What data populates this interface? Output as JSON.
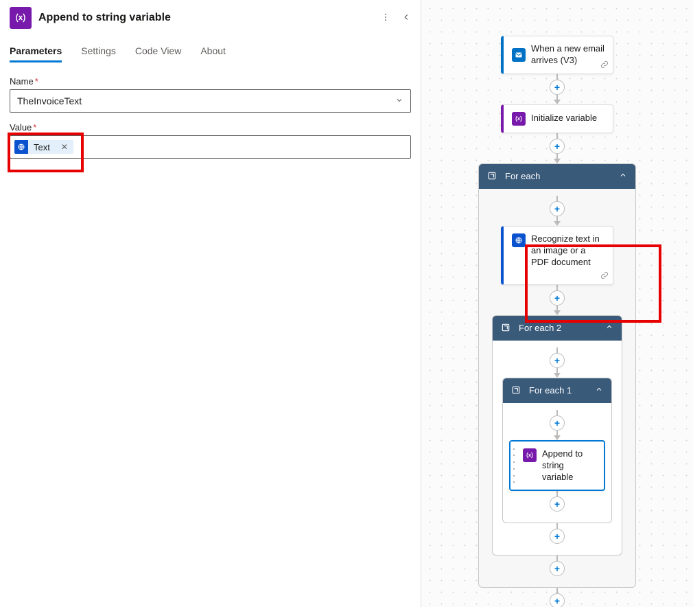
{
  "panel": {
    "title": "Append to string variable",
    "icon_label": "{x}"
  },
  "tabs": [
    "Parameters",
    "Settings",
    "Code View",
    "About"
  ],
  "form": {
    "name_label": "Name",
    "name_value": "TheInvoiceText",
    "value_label": "Value",
    "token": {
      "text": "Text"
    }
  },
  "canvas": {
    "cards": {
      "trigger": "When a new email arrives (V3)",
      "init_var": "Initialize variable",
      "for_each": "For each",
      "recognize": "Recognize text in an image or a PDF document",
      "for_each_2": "For each 2",
      "for_each_1": "For each 1",
      "append": "Append to string variable"
    }
  }
}
